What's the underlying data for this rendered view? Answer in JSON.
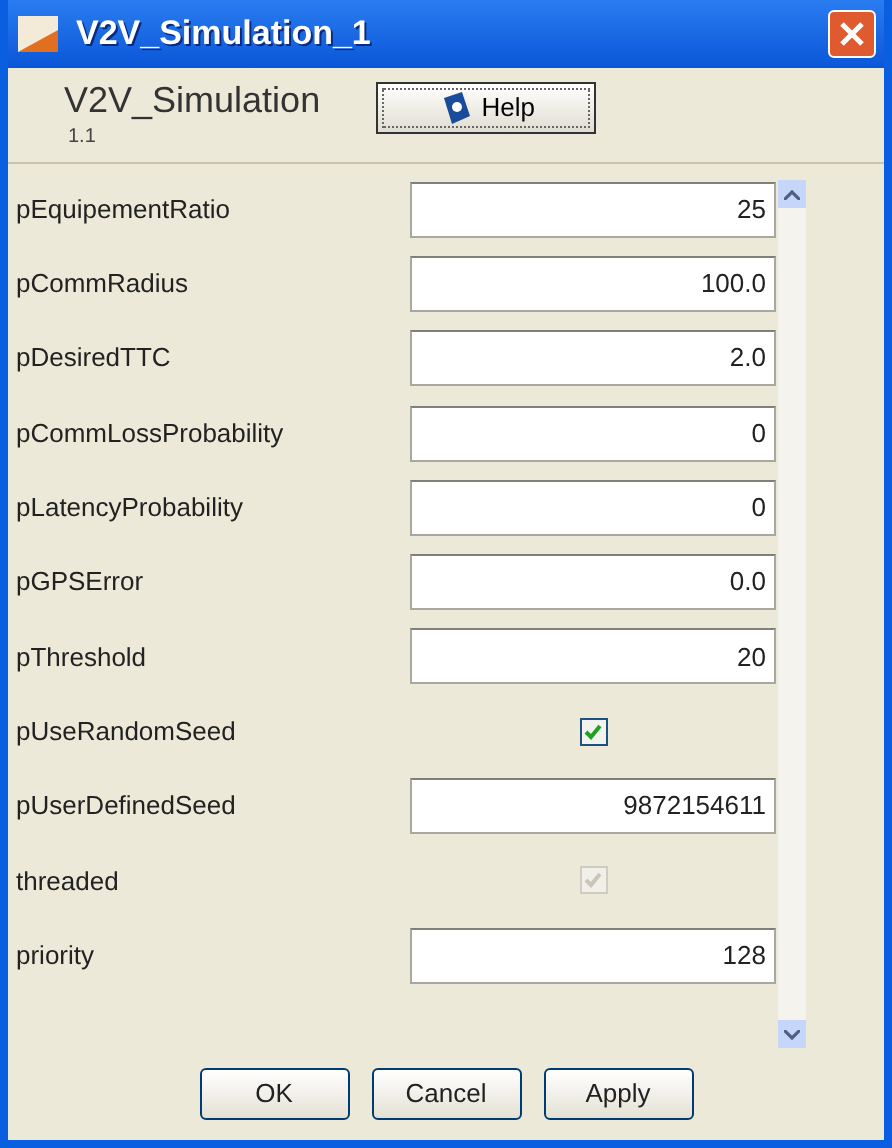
{
  "window": {
    "title": "V2V_Simulation_1"
  },
  "header": {
    "name": "V2V_Simulation",
    "version": "1.1",
    "help_button": "Help"
  },
  "parameters": [
    {
      "label": "pEquipementRatio",
      "kind": "field",
      "value": "25"
    },
    {
      "label": "pCommRadius",
      "kind": "field",
      "value": "100.0"
    },
    {
      "label": "pDesiredTTC",
      "kind": "field",
      "value": "2.0"
    },
    {
      "label": "pCommLossProbability",
      "kind": "field",
      "value": "0"
    },
    {
      "label": "pLatencyProbability",
      "kind": "field",
      "value": "0"
    },
    {
      "label": "pGPSError",
      "kind": "field",
      "value": "0.0"
    },
    {
      "label": "pThreshold",
      "kind": "field",
      "value": "20"
    },
    {
      "label": "pUseRandomSeed",
      "kind": "checkbox",
      "checked": true,
      "disabled": false
    },
    {
      "label": "pUserDefinedSeed",
      "kind": "field",
      "value": "9872154611"
    },
    {
      "label": "threaded",
      "kind": "checkbox",
      "checked": true,
      "disabled": true
    },
    {
      "label": "priority",
      "kind": "field",
      "value": "128"
    }
  ],
  "buttons": [
    "OK",
    "Cancel",
    "Apply"
  ]
}
